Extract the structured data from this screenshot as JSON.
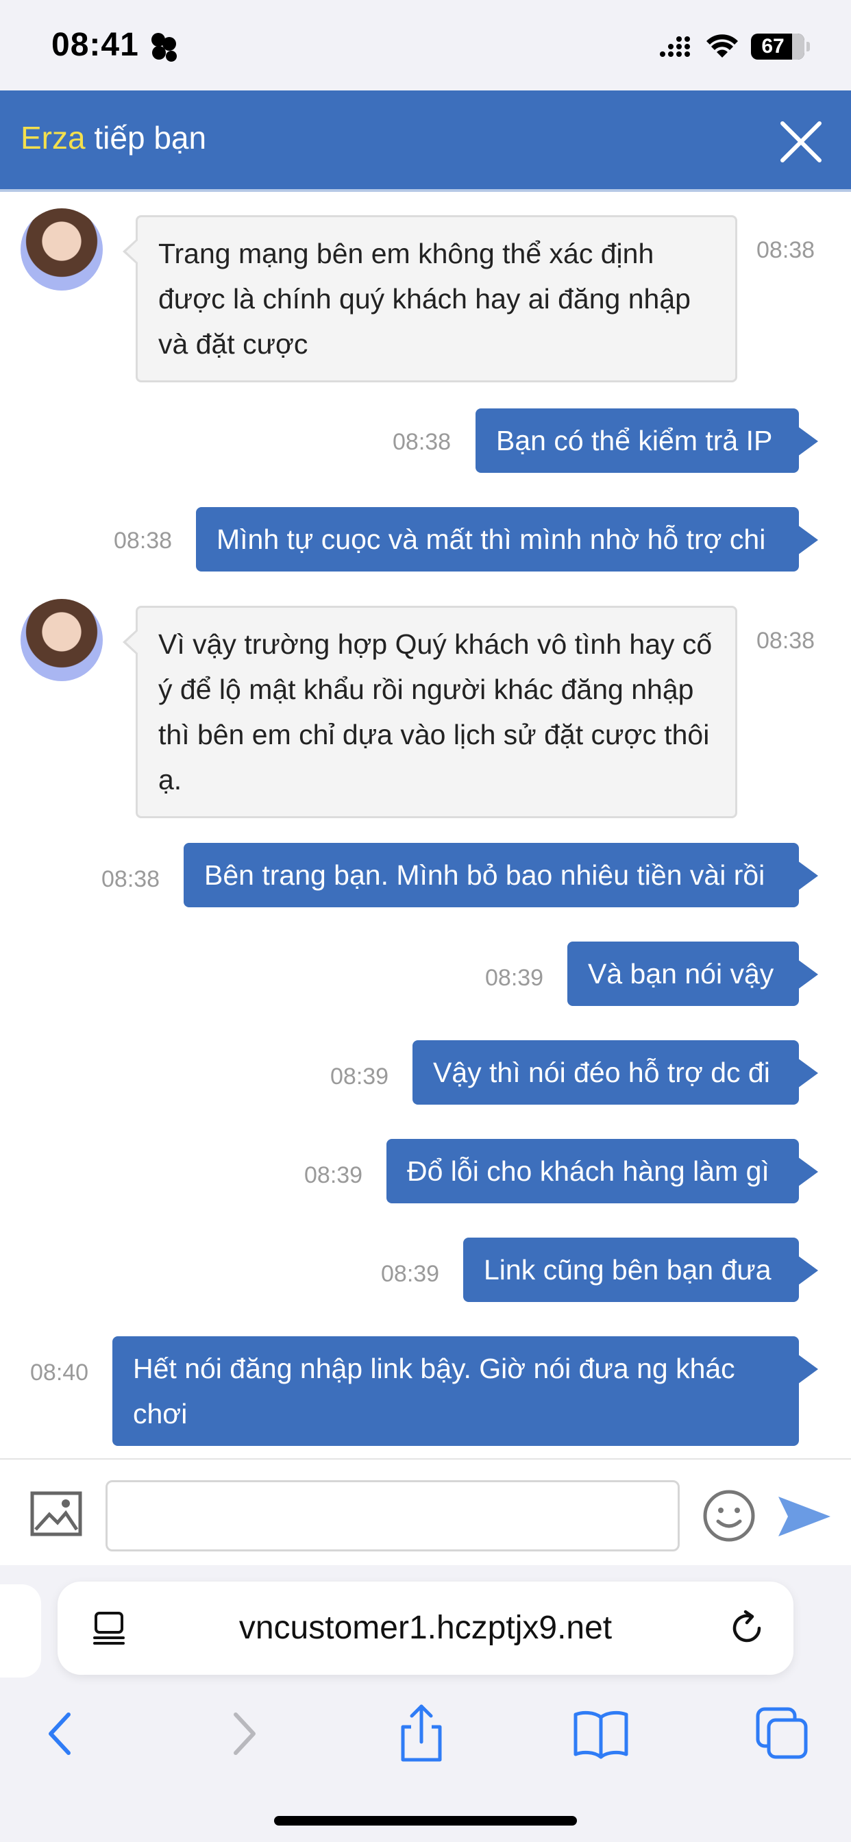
{
  "status_bar": {
    "time": "08:41",
    "battery": "67"
  },
  "header": {
    "agent_name": "Erza",
    "title_suffix": " tiếp bạn",
    "close_icon": "close-icon"
  },
  "messages": [
    {
      "side": "in",
      "time": "08:38",
      "text": "Trang mạng bên em không thể xác định được là chính quý khách hay ai đăng nhập và đặt cược"
    },
    {
      "side": "out",
      "time": "08:38",
      "text": "Bạn có thể kiểm trả IP"
    },
    {
      "side": "out",
      "time": "08:38",
      "text": "Mình tự cuọc và mất thì mình nhờ hỗ trợ chi"
    },
    {
      "side": "in",
      "time": "08:38",
      "text": "Vì vậy trường hợp Quý khách vô tình hay cố ý để lộ mật khẩu rồi người khác đăng nhập thì bên em chỉ dựa vào lịch sử đặt cược thôi ạ."
    },
    {
      "side": "out",
      "time": "08:38",
      "text": "Bên trang bạn. Mình bỏ bao nhiêu tiền vài rồi"
    },
    {
      "side": "out",
      "time": "08:39",
      "text": "Và bạn nói vậy"
    },
    {
      "side": "out",
      "time": "08:39",
      "text": "Vậy thì nói đéo hỗ trợ dc đi"
    },
    {
      "side": "out",
      "time": "08:39",
      "text": "Đổ lỗi cho khách hàng làm gì"
    },
    {
      "side": "out",
      "time": "08:39",
      "text": "Link cũng bên bạn đưa"
    },
    {
      "side": "out",
      "time": "08:40",
      "text": "Hết nói đăng nhập link bậy. Giờ nói đưa ng khác chơi"
    }
  ],
  "composer": {
    "placeholder": "",
    "image_icon": "image-icon",
    "emoji_icon": "smiley-icon",
    "send_icon": "send-icon"
  },
  "browser": {
    "url": "vncustomer1.hczptjx9.net",
    "nav_icons": [
      "back-icon",
      "forward-icon",
      "share-icon",
      "bookmarks-icon",
      "tabs-icon"
    ]
  },
  "colors": {
    "accent": "#3d6fbc",
    "agent_name": "#f4e04d",
    "incoming_bubble": "#f4f4f4",
    "timestamp": "#9a9a9a",
    "ios_blue": "#2f7cf6"
  }
}
